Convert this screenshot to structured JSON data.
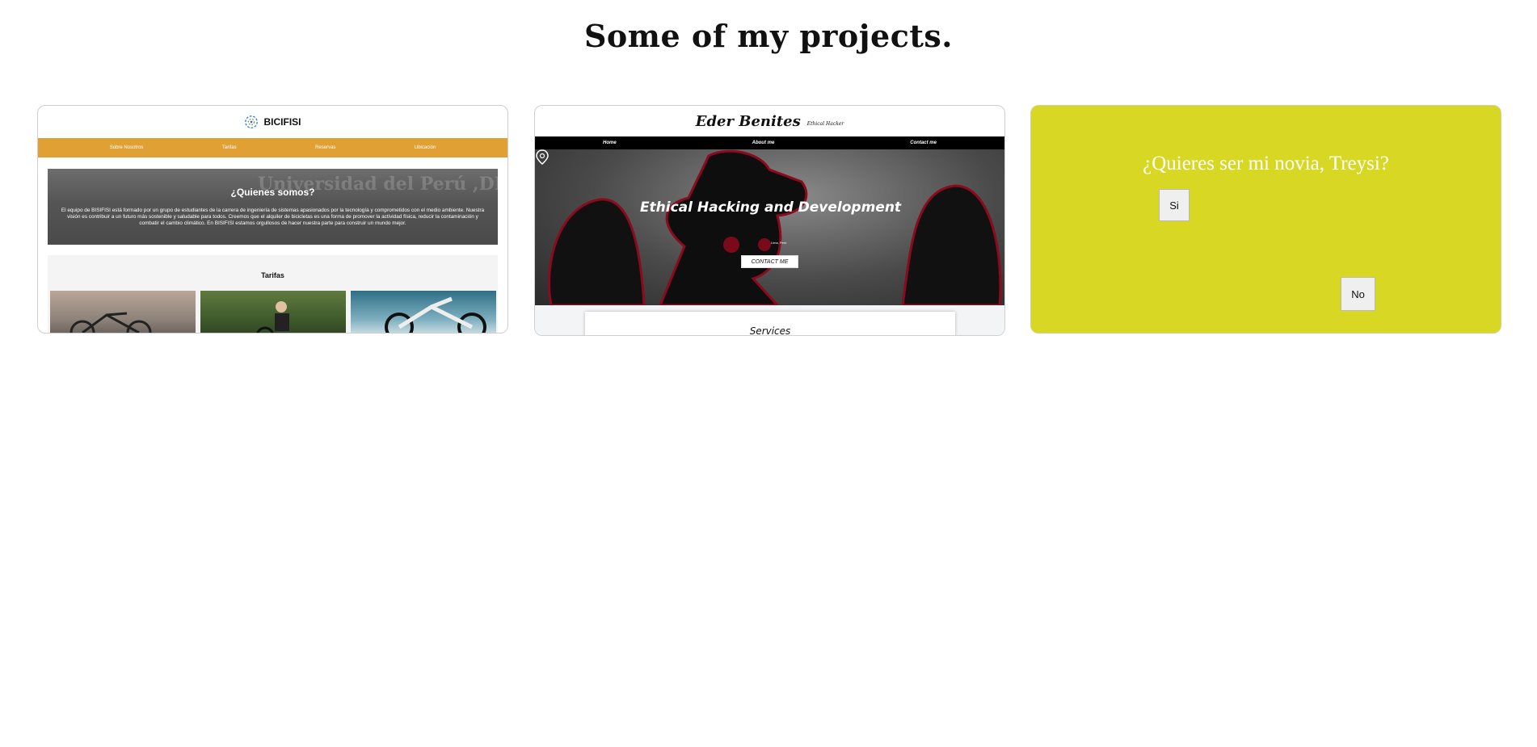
{
  "page": {
    "title": "Some of my projects."
  },
  "projects": [
    {
      "brand": "BICIFISI",
      "nav": [
        "Sobre Nosotros",
        "Tarifas",
        "Reservas",
        "Ubicación"
      ],
      "hero_title": "¿Quienes somos?",
      "hero_sign": "Universidad del Perú ,DECANA DE AMÉRICA",
      "hero_text": "El equipo de BISIFISI está formado por un grupo de estudiantes de la carrera de ingeniería de sistemas apasionados por la tecnología y comprometidos con el medio ambiente. Nuestra visión es contribuir a un futuro más sostenible y saludable para todos. Creemos que el alquiler de bicicletas es una forma de promover la actividad física, reducir la contaminación y combatir el cambio climático. En BISIFISI estamos orgullosos de hacer nuestra parte para construir un mundo mejor.",
      "section_title": "Tarifas"
    },
    {
      "name": "Eder Benites",
      "tagline": "Ethical Hacker",
      "nav": [
        "Home",
        "About me",
        "Contact me"
      ],
      "hero_title": "Ethical Hacking and Development",
      "location": "Lima, Perú",
      "cta": "CONTACT ME",
      "section_title": "Services"
    },
    {
      "question": "¿Quieres ser mi novia, Treysi?",
      "yes_label": "Si",
      "no_label": "No",
      "background": "#d8d824"
    }
  ]
}
